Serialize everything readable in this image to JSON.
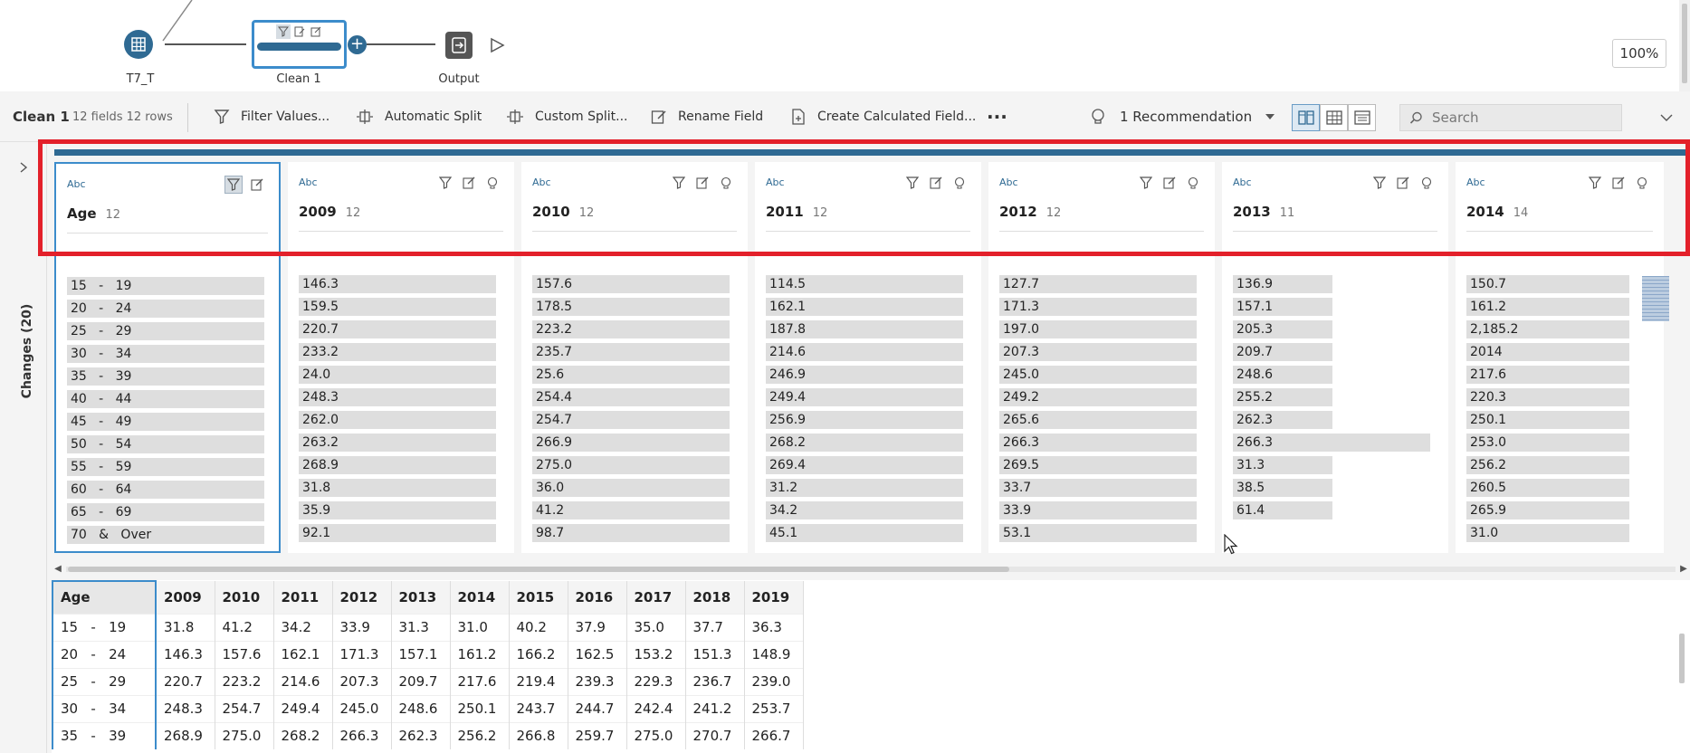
{
  "flow": {
    "input_label": "T7_T",
    "clean_label": "Clean 1",
    "output_label": "Output",
    "zoom": "100%"
  },
  "toolbar": {
    "step_title": "Clean 1",
    "step_meta": "12 fields  12 rows",
    "filter_values": "Filter Values...",
    "automatic_split": "Automatic Split",
    "custom_split": "Custom Split...",
    "rename_field": "Rename Field",
    "create_calculated_field": "Create Calculated Field...",
    "more": "···",
    "recommendation": "1 Recommendation",
    "search_placeholder": "Search"
  },
  "changes": {
    "label": "Changes (20)"
  },
  "profile": {
    "type_label": "Abc",
    "cards": [
      {
        "name": "Age",
        "count": "12",
        "values": [
          "15   -   19",
          "20   -   24",
          "25   -   29",
          "30   -   34",
          "35   -   39",
          "40   -   44",
          "45   -   49",
          "50   -   54",
          "55   -   59",
          "60   -   64",
          "65   -   69",
          "70   &   Over"
        ]
      },
      {
        "name": "2009",
        "count": "12",
        "values": [
          "146.3",
          "159.5",
          "220.7",
          "233.2",
          "24.0",
          "248.3",
          "262.0",
          "263.2",
          "268.9",
          "31.8",
          "35.9",
          "92.1"
        ]
      },
      {
        "name": "2010",
        "count": "12",
        "values": [
          "157.6",
          "178.5",
          "223.2",
          "235.7",
          "25.6",
          "254.4",
          "254.7",
          "266.9",
          "275.0",
          "36.0",
          "41.2",
          "98.7"
        ]
      },
      {
        "name": "2011",
        "count": "12",
        "values": [
          "114.5",
          "162.1",
          "187.8",
          "214.6",
          "246.9",
          "249.4",
          "256.9",
          "268.2",
          "269.4",
          "31.2",
          "34.2",
          "45.1"
        ]
      },
      {
        "name": "2012",
        "count": "12",
        "values": [
          "127.7",
          "171.3",
          "197.0",
          "207.3",
          "245.0",
          "249.2",
          "265.6",
          "266.3",
          "269.5",
          "33.7",
          "33.9",
          "53.1"
        ]
      },
      {
        "name": "2013",
        "count": "11",
        "values": [
          "136.9",
          "157.1",
          "205.3",
          "209.7",
          "248.6",
          "255.2",
          "262.3",
          "266.3",
          "31.3",
          "38.5",
          "61.4"
        ]
      },
      {
        "name": "2014",
        "count": "14",
        "values": [
          "150.7",
          "161.2",
          "2,185.2",
          "2014",
          "217.6",
          "220.3",
          "250.1",
          "253.0",
          "256.2",
          "260.5",
          "265.9",
          "31.0"
        ]
      }
    ]
  },
  "grid": {
    "headers": [
      "Age",
      "2009",
      "2010",
      "2011",
      "2012",
      "2013",
      "2014",
      "2015",
      "2016",
      "2017",
      "2018",
      "2019"
    ],
    "rows": [
      [
        "15   -   19",
        "31.8",
        "41.2",
        "34.2",
        "33.9",
        "31.3",
        "31.0",
        "40.2",
        "37.9",
        "35.0",
        "37.7",
        "36.3"
      ],
      [
        "20   -   24",
        "146.3",
        "157.6",
        "162.1",
        "171.3",
        "157.1",
        "161.2",
        "166.2",
        "162.5",
        "153.2",
        "151.3",
        "148.9"
      ],
      [
        "25   -   29",
        "220.7",
        "223.2",
        "214.6",
        "207.3",
        "209.7",
        "217.6",
        "219.4",
        "239.3",
        "229.3",
        "236.7",
        "239.0"
      ],
      [
        "30   -   34",
        "248.3",
        "254.7",
        "249.4",
        "245.0",
        "248.6",
        "250.1",
        "243.7",
        "244.7",
        "242.4",
        "241.2",
        "253.7"
      ],
      [
        "35   -   39",
        "268.9",
        "275.0",
        "268.2",
        "266.3",
        "262.3",
        "256.2",
        "266.8",
        "259.7",
        "275.0",
        "270.7",
        "266.7"
      ]
    ]
  },
  "colors": {
    "accent": "#2f6a93",
    "selection": "#3c8ccb",
    "highlight": "#e3202a"
  }
}
